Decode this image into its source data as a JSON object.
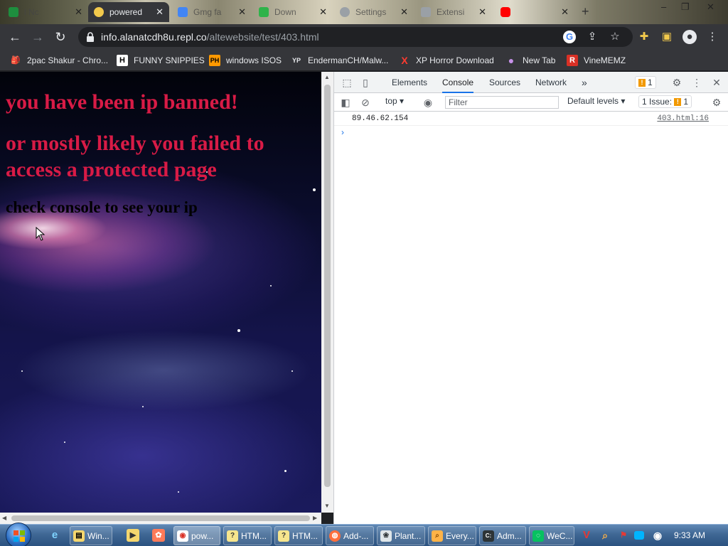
{
  "browser": {
    "tabs": [
      {
        "title": "l Nc",
        "active": false,
        "favicon_color": "#1e8e3e"
      },
      {
        "title": "powered",
        "active": true,
        "favicon_color": "#f2c94c"
      },
      {
        "title": "Gmg fa",
        "active": false,
        "favicon_color": "#4285f4"
      },
      {
        "title": "Down",
        "active": false,
        "favicon_color": "#2fb34a"
      },
      {
        "title": "Settings",
        "active": false,
        "favicon_color": "#9aa0a6"
      },
      {
        "title": "Extensi",
        "active": false,
        "favicon_color": "#9aa0a6"
      },
      {
        "title": "",
        "active": false,
        "favicon_color": "#ff0000"
      }
    ],
    "close_glyph": "✕",
    "new_tab_glyph": "+",
    "window_controls": {
      "minimize": "–",
      "maximize": "❐",
      "close": "✕"
    },
    "nav": {
      "back": "←",
      "forward": "→",
      "reload": "↻"
    },
    "url": {
      "host": "info.alanatcdh8u.repl.co",
      "path": "/altewebsite/test/403.html"
    },
    "bookmarks": [
      {
        "label": "2pac Shakur - Chro...",
        "icon": "🎒",
        "icon_bg": "transparent",
        "icon_fg": "#e8eaed"
      },
      {
        "label": "FUNNY SNIPPIES",
        "icon": "H",
        "icon_bg": "#ffffff",
        "icon_fg": "#000000"
      },
      {
        "label": "windows ISOS",
        "icon": "PH",
        "icon_bg": "#ff9900",
        "icon_fg": "#000000"
      },
      {
        "label": "EndermanCH/Malw...",
        "icon": "YP",
        "icon_bg": "#202124",
        "icon_fg": "#e8eaed"
      },
      {
        "label": "XP Horror Download",
        "icon": "X",
        "icon_bg": "transparent",
        "icon_fg": "#ff3b30"
      },
      {
        "label": "New Tab",
        "icon": "●",
        "icon_bg": "transparent",
        "icon_fg": "#c792ea"
      },
      {
        "label": "VineMEMZ",
        "icon": "R",
        "icon_bg": "#d93025",
        "icon_fg": "#ffffff"
      }
    ]
  },
  "page": {
    "heading1": "you have been ip banned!",
    "heading2_line1": "or mostly likely you failed to",
    "heading2_line2": "access a protected page",
    "instruction": "check console to see your ip",
    "heading_color": "#d81b46"
  },
  "devtools": {
    "tabs": [
      "Elements",
      "Console",
      "Sources",
      "Network"
    ],
    "active_tab": "Console",
    "more_tabs_glyph": "»",
    "issues_badge_count": "1",
    "context_select": "top",
    "filter_placeholder": "Filter",
    "levels_select": "Default levels",
    "issues_label": "1 Issue:",
    "issues_count": "1",
    "log_message": "89.46.62.154",
    "log_source": "403.html:16",
    "prompt_glyph": "›"
  },
  "taskbar": {
    "buttons": [
      {
        "label": "Win...",
        "icon_bg": "#f5d76e",
        "icon": "▤"
      },
      {
        "label": "pow...",
        "icon_bg": "#ffffff",
        "icon": "◉",
        "active": true
      },
      {
        "label": "HTM...",
        "icon_bg": "#f6e58d",
        "icon": "?"
      },
      {
        "label": "HTM...",
        "icon_bg": "#f6e58d",
        "icon": "?"
      },
      {
        "label": "Add-...",
        "icon_bg": "#ff6f3c",
        "icon": "◍"
      },
      {
        "label": "Plant...",
        "icon_bg": "#dfe6e9",
        "icon": "❀"
      },
      {
        "label": "Every...",
        "icon_bg": "#ffb347",
        "icon": "⌕"
      },
      {
        "label": "Adm...",
        "icon_bg": "#2d3436",
        "icon": "C:"
      },
      {
        "label": "WeC...",
        "icon_bg": "#07c160",
        "icon": "◌"
      }
    ],
    "clock": "9:33 AM"
  }
}
